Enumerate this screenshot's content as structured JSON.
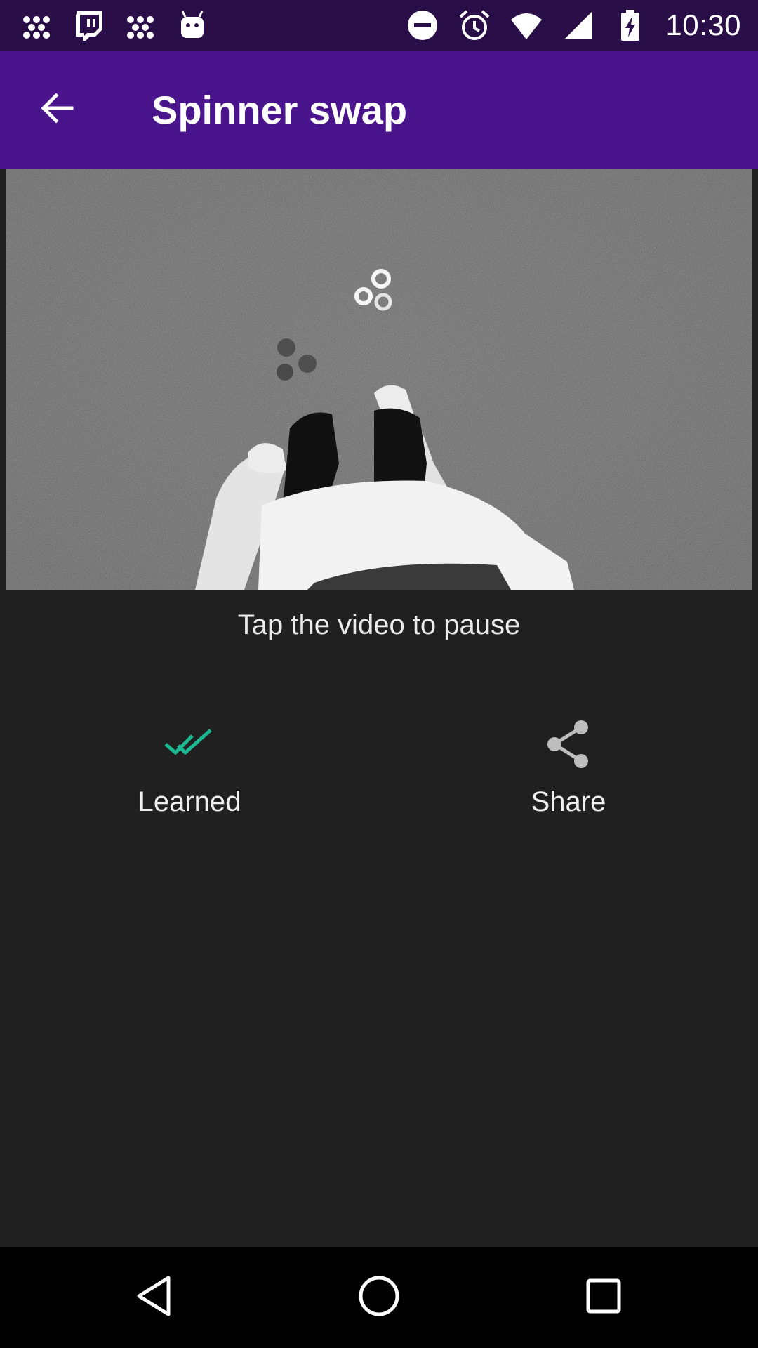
{
  "status_bar": {
    "time": "10:30",
    "left_icons": [
      "dots-app-icon",
      "twitch-icon",
      "dots-app-icon",
      "android-icon"
    ],
    "right_icons": [
      "do-not-disturb-icon",
      "alarm-icon",
      "wifi-icon",
      "signal-icon",
      "battery-charging-icon"
    ]
  },
  "app_bar": {
    "title": "Spinner swap",
    "back_icon": "arrow-back-icon"
  },
  "video": {
    "hint": "Tap the video to pause"
  },
  "actions": {
    "learned_label": "Learned",
    "learned_icon": "double-check-icon",
    "share_label": "Share",
    "share_icon": "share-icon"
  },
  "nav_bar": {
    "back_icon": "nav-back-icon",
    "home_icon": "nav-home-icon",
    "recents_icon": "nav-recents-icon"
  },
  "colors": {
    "status_bar": "#2a0e47",
    "app_bar": "#4a148c",
    "background": "#202020",
    "learned_accent": "#1db992",
    "share_icon": "#bdbdbd"
  }
}
